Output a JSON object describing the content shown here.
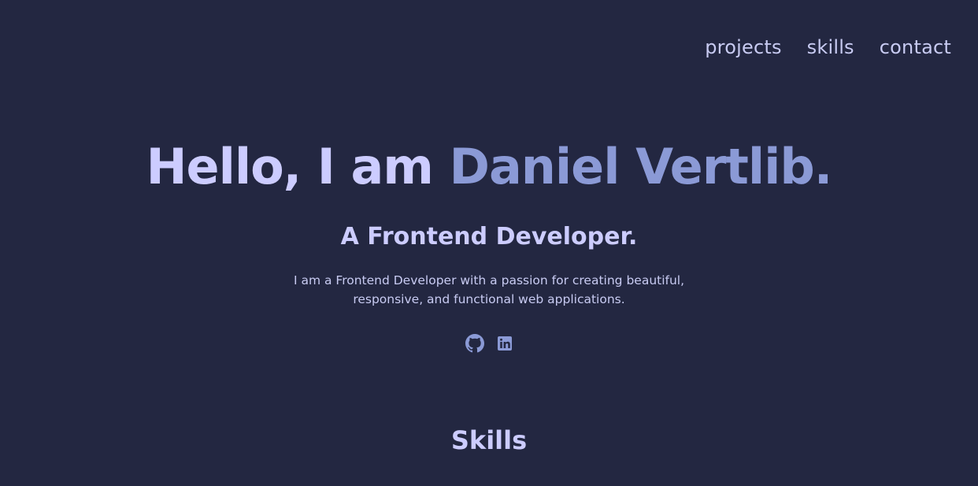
{
  "nav": {
    "items": [
      {
        "label": "projects"
      },
      {
        "label": "skills"
      },
      {
        "label": "contact"
      }
    ]
  },
  "hero": {
    "greeting": "Hello, I am ",
    "name": "Daniel Vertlib.",
    "subtitle": "A Frontend Developer.",
    "description": "I am a Frontend Developer with a passion for creating beautiful, responsive, and functional web applications."
  },
  "social": {
    "icons": [
      "github-icon",
      "linkedin-icon"
    ]
  },
  "sections": {
    "skills_title": "Skills"
  },
  "colors": {
    "background": "#232741",
    "text_light": "#ccccff",
    "accent": "#8b9ad6"
  }
}
